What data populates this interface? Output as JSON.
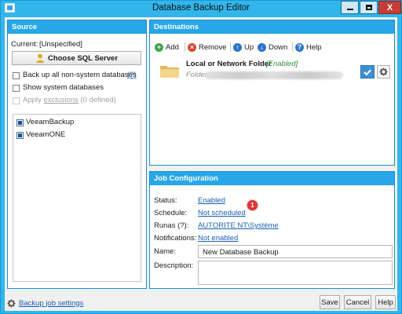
{
  "window": {
    "title": "Database Backup Editor",
    "close_glyph": "X"
  },
  "source": {
    "title": "Source",
    "current_label": "Current:",
    "current_value": "[Unspecified]",
    "choose_button": "Choose SQL Server",
    "opt_backup_all": "Back up all non-system databases",
    "opt_backup_all_help": "(?)",
    "opt_show_system": "Show system databases",
    "opt_apply_prefix": "Apply ",
    "opt_apply_link": "exclusions",
    "opt_apply_suffix": " (0 defined)",
    "databases": [
      {
        "name": "VeeamBackup",
        "checked": true
      },
      {
        "name": "VeeamONE",
        "checked": true
      }
    ]
  },
  "destinations": {
    "title": "Destinations",
    "toolbar": {
      "add": "Add",
      "remove": "Remove",
      "up": "Up",
      "down": "Down",
      "help": "Help"
    },
    "items": [
      {
        "name": "Local or Network Folder",
        "status": "[Enabled]",
        "detail": "Folder (\\\\"
      }
    ]
  },
  "job": {
    "title": "Job Configuration",
    "status_label": "Status:",
    "status_value": "Enabled",
    "schedule_label": "Schedule:",
    "schedule_value": "Not scheduled",
    "schedule_badge": "1",
    "runas_label": "Runas (?):",
    "runas_value": "AUTORITE NT\\Système",
    "notifications_label": "Notifications:",
    "notifications_value": "Not enabled",
    "name_label": "Name:",
    "name_value": "New Database Backup",
    "description_label": "Description:",
    "description_value": ""
  },
  "footer": {
    "settings_link": "Backup job settings",
    "save": "Save",
    "cancel": "Cancel",
    "help": "Help"
  },
  "colors": {
    "accent": "#32b5ea",
    "panel_header": "#27a7e8",
    "link": "#1a5fb4",
    "badge": "#d93636"
  }
}
